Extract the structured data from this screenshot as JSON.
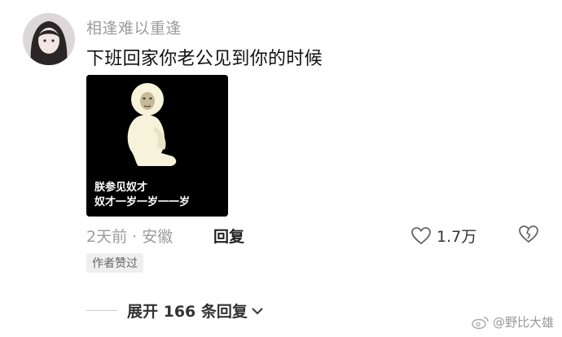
{
  "comment": {
    "username": "相逢难以重逢",
    "text": "下班回家你老公见到你的时候",
    "meme_caption_line1": "朕参见奴才",
    "meme_caption_line2": "奴才一岁一岁一一岁",
    "time_location": "2天前 · 安徽",
    "reply_label": "回复",
    "like_count": "1.7万",
    "author_badge": "作者赞过",
    "expand_replies": "展开 166 条回复"
  },
  "watermark": {
    "text": "@野比大雄"
  }
}
